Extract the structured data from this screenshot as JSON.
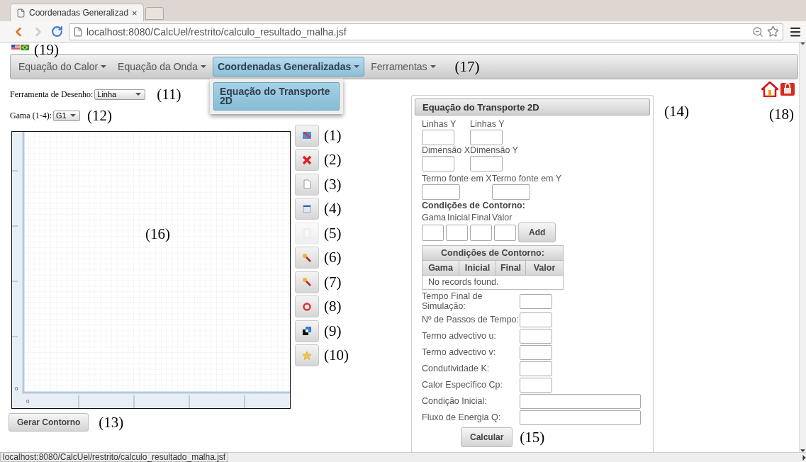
{
  "browser": {
    "tab_title": "Coordenadas Generalizad",
    "tab_close": "×",
    "url": "localhost:8080/CalcUel/restrito/calculo_resultado_malha.jsf",
    "status_url": "localhost:8080/CalcUel/restrito/calculo_resultado_malha.jsf"
  },
  "languages_note": "(19)",
  "menu": {
    "note": "(17)",
    "items": [
      {
        "label": "Equação do Calor",
        "selected": false
      },
      {
        "label": "Equação da Onda",
        "selected": false
      },
      {
        "label": "Coordenadas Generalizadas",
        "selected": true,
        "dropdown": [
          "Equação do Transporte 2D"
        ]
      },
      {
        "label": "Ferramentas",
        "selected": false
      }
    ]
  },
  "drawing_tool": {
    "label": "Ferramenta de Desenho:",
    "value": "Linha",
    "note": "(11)"
  },
  "gamma": {
    "label": "Gama (1-4):",
    "value": "G1",
    "note": "(12)"
  },
  "canvas": {
    "note": "(16)",
    "x_origin": "0",
    "y_origin": "0"
  },
  "tools": [
    {
      "kind": "edit",
      "note": "(1)",
      "disabled": false
    },
    {
      "kind": "delete",
      "note": "(2)",
      "disabled": false
    },
    {
      "kind": "page",
      "note": "(3)",
      "disabled": false
    },
    {
      "kind": "grid",
      "note": "(4)",
      "disabled": false
    },
    {
      "kind": "table",
      "note": "(5)",
      "disabled": true
    },
    {
      "kind": "wand",
      "note": "(6)",
      "disabled": false
    },
    {
      "kind": "wand",
      "note": "(7)",
      "disabled": false
    },
    {
      "kind": "undo",
      "note": "(8)",
      "disabled": false
    },
    {
      "kind": "layers",
      "note": "(9)",
      "disabled": false
    },
    {
      "kind": "star",
      "note": "(10)",
      "disabled": false
    }
  ],
  "generate": {
    "label": "Gerar Contorno",
    "note": "(13)"
  },
  "panel": {
    "title": "Equação do Transporte 2D",
    "note": "(14)",
    "pair_fields": [
      [
        "Linhas Y",
        "Linhas Y"
      ],
      [
        "Dimensão X",
        "Dimensão Y"
      ]
    ],
    "source_fields": [
      "Termo fonte em X",
      "Termo fonte em Y"
    ],
    "boundary": {
      "title": "Condições de Contorno:",
      "labels": [
        "Gama",
        "Inicial",
        "Final",
        "Valor"
      ],
      "add": "Add",
      "table": {
        "title": "Condições de Contorno:",
        "columns": [
          "Gama",
          "Inicial",
          "Final",
          "Valor"
        ],
        "empty": "No records found."
      }
    },
    "params": [
      {
        "label": "Tempo Final de Simulação:",
        "kind": "short"
      },
      {
        "label": "Nº de Passos de Tempo:",
        "kind": "short"
      },
      {
        "label": "Termo advectivo u:",
        "kind": "short"
      },
      {
        "label": "Termo advectivo v:",
        "kind": "short"
      },
      {
        "label": "Condutividade K:",
        "kind": "short"
      },
      {
        "label": "Calor Específico Cp:",
        "kind": "short"
      },
      {
        "label": "Condição Inicial:",
        "kind": "wide"
      },
      {
        "label": "Fluxo de Energia Q:",
        "kind": "wide"
      }
    ],
    "submit": "Calcular",
    "submit_note": "(15)"
  },
  "header_icons_note": "(18)"
}
